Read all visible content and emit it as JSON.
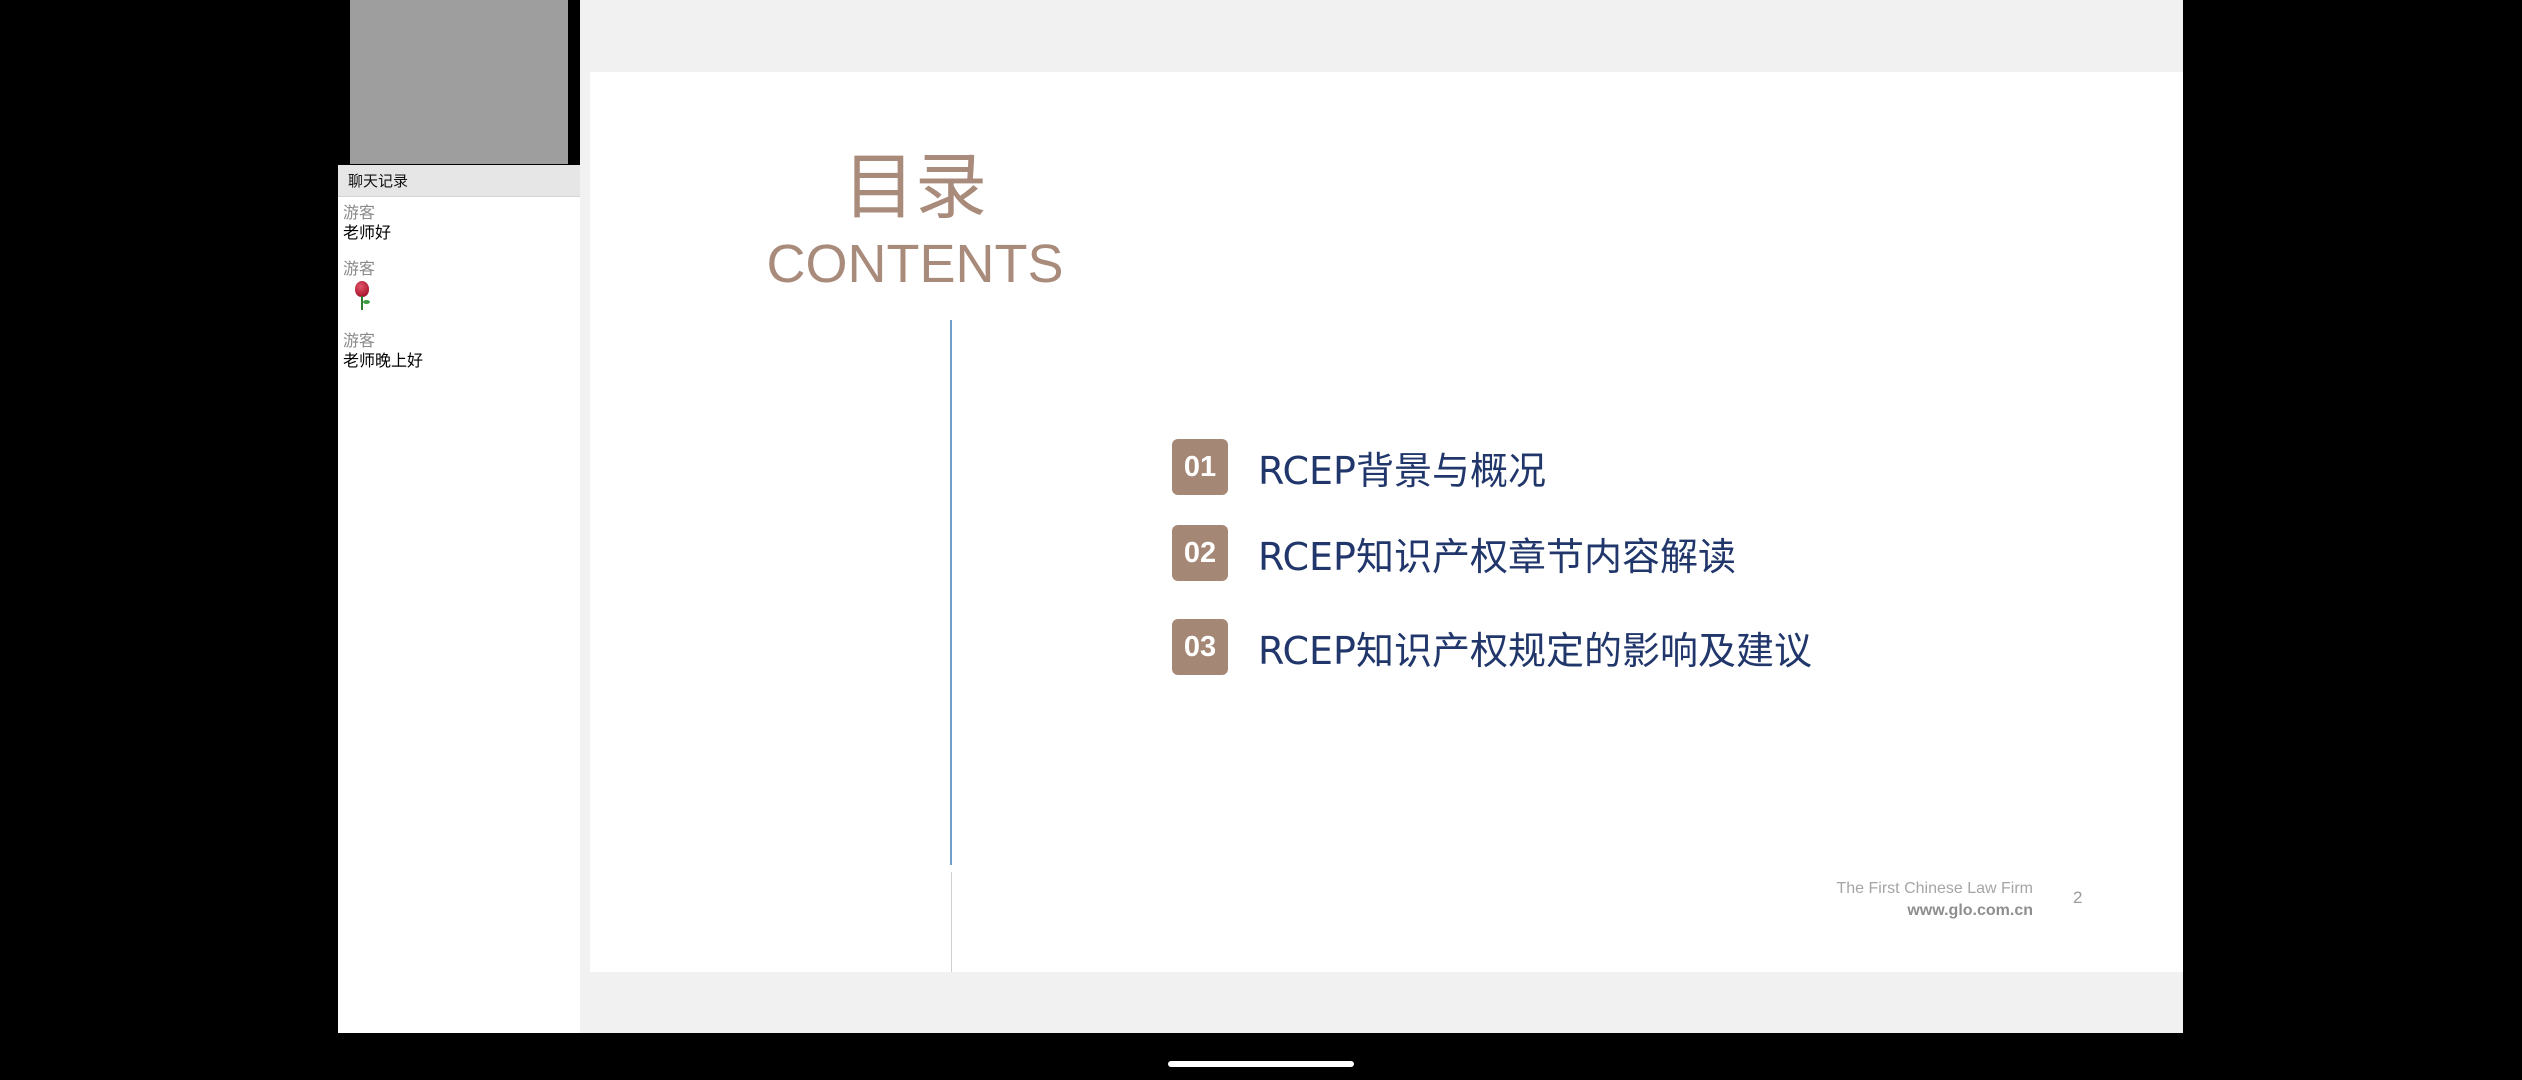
{
  "chat": {
    "header": "聊天记录",
    "messages": [
      {
        "user": "游客",
        "text": "老师好"
      },
      {
        "user": "游客",
        "emoji": "rose-icon"
      },
      {
        "user": "游客",
        "text": "老师晚上好"
      }
    ]
  },
  "slide": {
    "title_cn": "目录",
    "title_en": "CONTENTS",
    "items": [
      {
        "num": "01",
        "label": "RCEP背景与概况"
      },
      {
        "num": "02",
        "label": "RCEP知识产权章节内容解读"
      },
      {
        "num": "03",
        "label": "RCEP知识产权规定的影响及建议"
      }
    ],
    "footer": {
      "firm": "The First Chinese Law Firm",
      "url": "www.glo.com.cn"
    },
    "page_number": "2"
  },
  "colors": {
    "accent_brown": "#a58775",
    "title_brown": "#a98b7b",
    "item_navy": "#21376b",
    "divider_blue": "#6f9fcc"
  }
}
